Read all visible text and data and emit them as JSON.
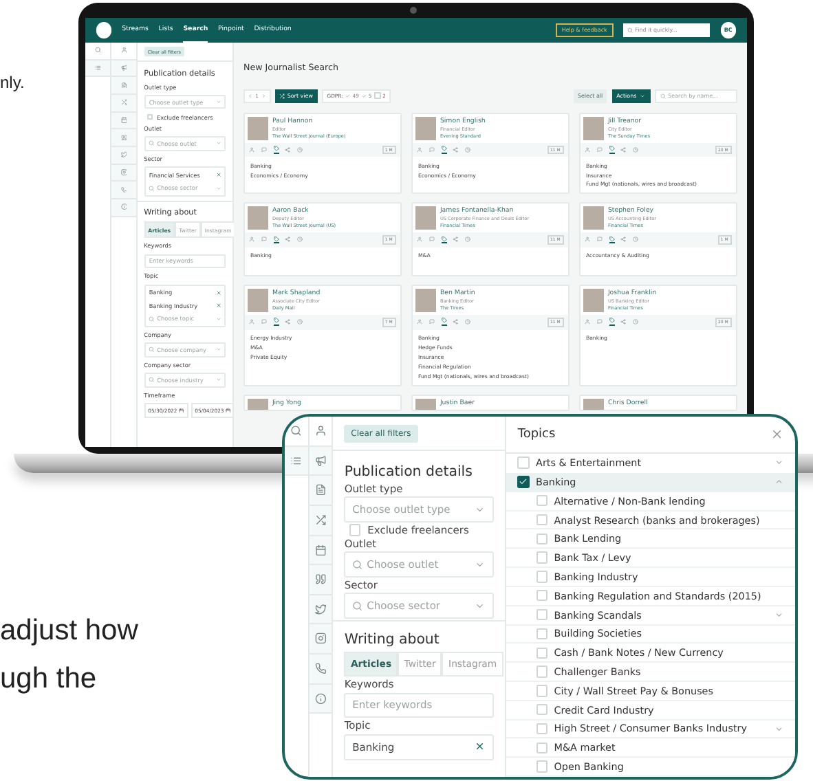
{
  "page_text": {
    "top": "nly.",
    "bottom": [
      "adjust how",
      "ugh the"
    ]
  },
  "app": {
    "nav": {
      "items": [
        {
          "label": "Streams",
          "selected": false
        },
        {
          "label": "Lists",
          "selected": false
        },
        {
          "label": "Search",
          "selected": true
        },
        {
          "label": "Pinpoint",
          "selected": false
        },
        {
          "label": "Distribution",
          "selected": false
        }
      ],
      "help": "Help & feedback",
      "search_placeholder": "Find it quickly...",
      "avatar": "BC"
    },
    "filters": {
      "clear": "Clear all filters",
      "fields": [
        {
          "kind": "heading",
          "text": "Publication details"
        },
        {
          "kind": "label",
          "text": "Outlet type"
        },
        {
          "kind": "select",
          "placeholder": "Choose outlet type",
          "search": false
        },
        {
          "kind": "checkbox",
          "text": "Exclude freelancers",
          "checked": false
        },
        {
          "kind": "label",
          "text": "Outlet"
        },
        {
          "kind": "select",
          "placeholder": "Choose outlet",
          "search": true
        },
        {
          "kind": "label",
          "text": "Sector"
        },
        {
          "kind": "multiselect",
          "tags": [
            "Financial Services"
          ],
          "placeholder": "Choose sector"
        },
        {
          "kind": "heading",
          "text": "Writing about"
        },
        {
          "kind": "tabs",
          "tabs": [
            {
              "label": "Articles",
              "selected": true
            },
            {
              "label": "Twitter",
              "selected": false
            },
            {
              "label": "Instagram",
              "selected": false
            }
          ]
        },
        {
          "kind": "label",
          "text": "Keywords"
        },
        {
          "kind": "input",
          "placeholder": "Enter keywords"
        },
        {
          "kind": "label",
          "text": "Topic"
        },
        {
          "kind": "multiselect",
          "tags": [
            "Banking",
            "Banking Industry"
          ],
          "placeholder": "Choose topic"
        },
        {
          "kind": "label",
          "text": "Company"
        },
        {
          "kind": "select",
          "placeholder": "Choose company",
          "search": true
        },
        {
          "kind": "label",
          "text": "Company sector"
        },
        {
          "kind": "select",
          "placeholder": "Choose industry",
          "search": true
        },
        {
          "kind": "label",
          "text": "Timeframe"
        },
        {
          "kind": "dates",
          "values": [
            "05/30/2022",
            "05/04/2023"
          ]
        }
      ]
    },
    "results": {
      "title": "New Journalist Search",
      "page": "1",
      "sort": "Sort view",
      "gdpr": {
        "label": "GDPR:",
        "counts": [
          {
            "kind": "ok",
            "value": "49"
          },
          {
            "kind": "partial",
            "value": "5"
          },
          {
            "kind": "none",
            "value": "2"
          }
        ]
      },
      "select_all": "Select all",
      "actions": "Actions",
      "search_placeholder": "Search by name...",
      "cards": [
        {
          "name": "Paul Hannon",
          "role": "Editor",
          "outlet": "The Wall Street Journal (Europe)",
          "badge": "1 M",
          "topics": [
            "Banking",
            "Economics / Economy"
          ]
        },
        {
          "name": "Simon English",
          "role": "Financial Editor",
          "outlet": "Evening Standard",
          "badge": "11 M",
          "topics": [
            "Banking",
            "Economics / Economy"
          ]
        },
        {
          "name": "Jill Treanor",
          "role": "City Editor",
          "outlet": "The Sunday Times",
          "badge": "20 M",
          "topics": [
            "Banking",
            "Insurance",
            "Fund Mgt (nationals, wires and broadcast)"
          ]
        },
        {
          "name": "Aaron Back",
          "role": "Deputy Editor",
          "outlet": "The Wall Street Journal (US)",
          "badge": "1 M",
          "topics": [
            "Banking"
          ]
        },
        {
          "name": "James Fontanella-Khan",
          "role": "US Corporate Finance and Deals Editor",
          "outlet": "Financial Times",
          "badge": "11 M",
          "topics": [
            "M&A"
          ]
        },
        {
          "name": "Stephen Foley",
          "role": "US Accounting Editor",
          "outlet": "Financial Times",
          "badge": "1 M",
          "topics": [
            "Accountancy & Auditing"
          ]
        },
        {
          "name": "Mark Shapland",
          "role": "Associate City Editor",
          "outlet": "Daily Mail",
          "badge": "7 M",
          "topics": [
            "Energy Industry",
            "M&A",
            "Private Equity"
          ]
        },
        {
          "name": "Ben Martin",
          "role": "Banking Editor",
          "outlet": "The Times",
          "badge": "11 M",
          "topics": [
            "Banking",
            "Hedge Funds",
            "Insurance",
            "Financial Regulation",
            "Fund Mgt (nationals, wires and broadcast)"
          ]
        },
        {
          "name": "Joshua Franklin",
          "role": "US Banking Editor",
          "outlet": "Financial Times",
          "badge": "20 M",
          "topics": [
            "Banking"
          ]
        }
      ],
      "more_names": [
        "Jing Yong",
        "Justin Baer",
        "Chris Dorrell"
      ]
    }
  },
  "callout": {
    "filters": {
      "clear": "Clear all filters",
      "fields": [
        {
          "kind": "heading",
          "text": "Publication details"
        },
        {
          "kind": "label",
          "text": "Outlet type"
        },
        {
          "kind": "select",
          "placeholder": "Choose outlet type",
          "search": false
        },
        {
          "kind": "checkbox",
          "text": "Exclude freelancers",
          "checked": false
        },
        {
          "kind": "label",
          "text": "Outlet"
        },
        {
          "kind": "select",
          "placeholder": "Choose outlet",
          "search": true
        },
        {
          "kind": "label",
          "text": "Sector"
        },
        {
          "kind": "select",
          "placeholder": "Choose sector",
          "search": true
        },
        {
          "kind": "heading",
          "text": "Writing about"
        },
        {
          "kind": "tabs",
          "tabs": [
            {
              "label": "Articles",
              "selected": true
            },
            {
              "label": "Twitter",
              "selected": false
            },
            {
              "label": "Instagram",
              "selected": false
            }
          ]
        },
        {
          "kind": "label",
          "text": "Keywords"
        },
        {
          "kind": "input",
          "placeholder": "Enter keywords"
        },
        {
          "kind": "label",
          "text": "Topic"
        },
        {
          "kind": "multiselect",
          "tags": [
            "Banking"
          ]
        }
      ]
    },
    "topics": {
      "title": "Topics",
      "items": [
        {
          "label": "Arts & Entertainment",
          "checked": false,
          "expanded": false
        },
        {
          "label": "Banking",
          "checked": true,
          "expanded": true,
          "children": [
            {
              "label": "Alternative / Non-Bank lending",
              "checked": false,
              "expandable": false
            },
            {
              "label": "Analyst Research (banks and brokerages)",
              "checked": false,
              "expandable": false
            },
            {
              "label": "Bank Lending",
              "checked": false,
              "expandable": false
            },
            {
              "label": "Bank Tax / Levy",
              "checked": false,
              "expandable": false
            },
            {
              "label": "Banking Industry",
              "checked": false,
              "expandable": false
            },
            {
              "label": "Banking Regulation and Standards (2015)",
              "checked": false,
              "expandable": false
            },
            {
              "label": "Banking Scandals",
              "checked": false,
              "expandable": true
            },
            {
              "label": "Building Societies",
              "checked": false,
              "expandable": false
            },
            {
              "label": "Cash / Bank Notes / New Currency",
              "checked": false,
              "expandable": false
            },
            {
              "label": "Challenger Banks",
              "checked": false,
              "expandable": false
            },
            {
              "label": "City / Wall Street Pay & Bonuses",
              "checked": false,
              "expandable": false
            },
            {
              "label": "Credit Card Industry",
              "checked": false,
              "expandable": false
            },
            {
              "label": "High Street / Consumer Banks Industry",
              "checked": false,
              "expandable": true
            },
            {
              "label": "M&A market",
              "checked": false,
              "expandable": false
            },
            {
              "label": "Open Banking",
              "checked": false,
              "expandable": false
            }
          ]
        }
      ]
    }
  }
}
